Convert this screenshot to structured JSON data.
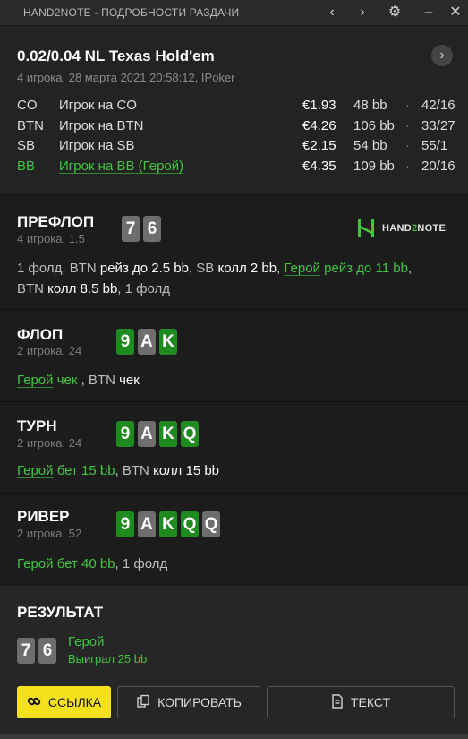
{
  "window": {
    "title": "HAND2NOTE - ПОДРОБНОСТИ РАЗДАЧИ",
    "back_icon": "chevron-left-icon",
    "forward_icon": "chevron-right-icon",
    "settings_icon": "gear-icon",
    "minimize_icon": "minimize-icon",
    "close_icon": "close-icon"
  },
  "hand": {
    "title": "0.02/0.04 NL Texas Hold'em",
    "subtitle": "4 игрока, 28 марта 2021 20:58:12, IPoker",
    "players": [
      {
        "pos": "CO",
        "name": "Игрок на CO",
        "stack": "€1.93",
        "bb": "48 bb",
        "sep": "·",
        "range": "42/16"
      },
      {
        "pos": "BTN",
        "name": "Игрок на BTN",
        "stack": "€4.26",
        "bb": "106 bb",
        "sep": "·",
        "range": "33/27"
      },
      {
        "pos": "SB",
        "name": "Игрок на SB",
        "stack": "€2.15",
        "bb": "54 bb",
        "sep": "·",
        "range": "55/1"
      },
      {
        "pos": "BB",
        "name": "Игрок на BB (Герой)",
        "stack": "€4.35",
        "bb": "109 bb",
        "sep": "·",
        "range": "20/16"
      }
    ]
  },
  "logo": {
    "word_a": "HAND",
    "word_b": "2",
    "word_c": "NOTE"
  },
  "preflop": {
    "name": "ПРЕФЛОП",
    "sub": "4 игрока, 1.5",
    "cards": [
      "7",
      "6"
    ],
    "line1": {
      "a": "1 фолд, BTN ",
      "b": "рейз до 2.5 bb",
      "c": ", SB ",
      "d": "колл 2 bb",
      "e": ", ",
      "f": "Герой",
      "g": " рейз до 11 bb",
      "h": ","
    },
    "line2": {
      "a": "BTN ",
      "b": "колл 8.5 bb",
      "c": ", 1 фолд"
    }
  },
  "flop": {
    "name": "ФЛОП",
    "sub": "2 игрока, 24",
    "cards": [
      "9",
      "A",
      "K"
    ],
    "line": {
      "a": "Герой",
      "b": " чек ",
      "c": ", BTN ",
      "d": "чек"
    }
  },
  "turn": {
    "name": "ТУРН",
    "sub": "2 игрока, 24",
    "cards": [
      "9",
      "A",
      "K",
      "Q"
    ],
    "line": {
      "a": "Герой",
      "b": " бет 15 bb",
      "c": ", BTN ",
      "d": "колл 15 bb"
    }
  },
  "river": {
    "name": "РИВЕР",
    "sub": "2 игрока, 52",
    "cards": [
      "9",
      "A",
      "K",
      "Q",
      "Q"
    ],
    "line": {
      "a": "Герой",
      "b": " бет 40 bb",
      "c": ", 1 фолд"
    }
  },
  "result": {
    "title": "РЕЗУЛЬТАТ",
    "cards": [
      "7",
      "6"
    ],
    "name": "Герой",
    "win": "Выиграл 25 bb"
  },
  "buttons": {
    "link": "ССЫЛКА",
    "copy": "КОПИРОВАТЬ",
    "text": "ТЕКСТ"
  },
  "colors": {
    "accent_green": "#3fc53f",
    "card_green": "#1f8a1f",
    "card_gray": "#6e6e6e",
    "link_yellow": "#f5e11b"
  }
}
